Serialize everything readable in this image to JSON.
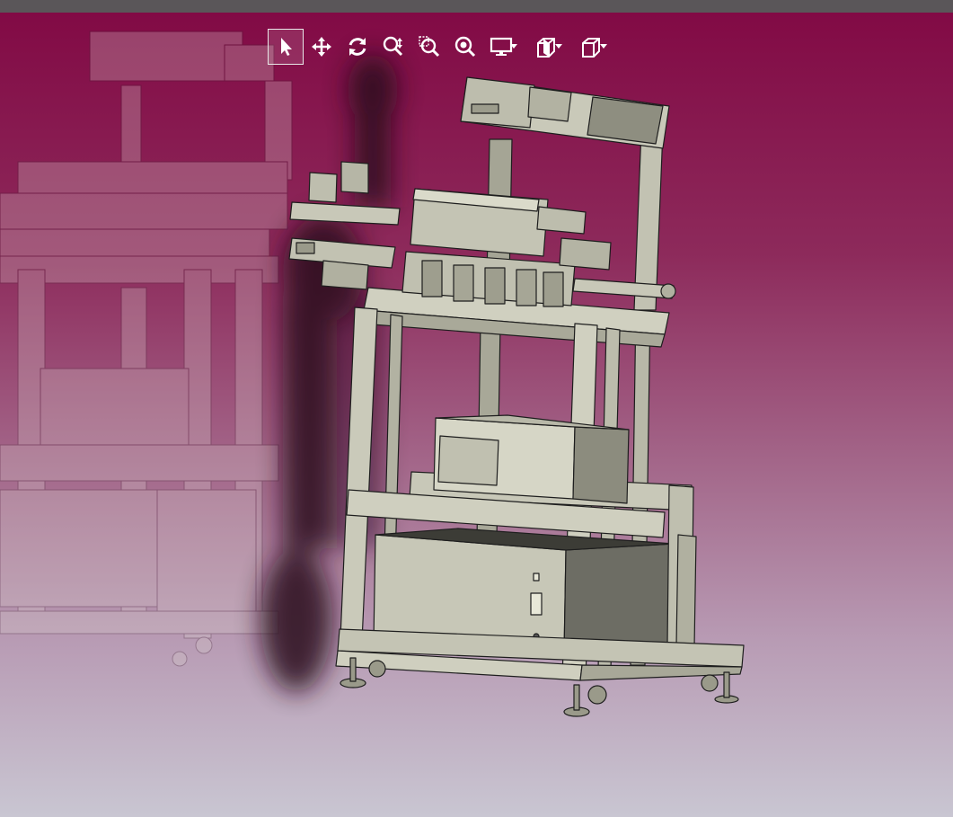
{
  "window": {
    "background_top": "#820a45",
    "background_bottom": "#c9c6d2",
    "topbar_color": "#5a5659"
  },
  "toolbar": {
    "buttons": [
      {
        "id": "select",
        "icon": "cursor-arrow-icon",
        "active": true
      },
      {
        "id": "pan",
        "icon": "move-arrows-icon",
        "active": false
      },
      {
        "id": "rotate",
        "icon": "rotate-icon",
        "active": false
      },
      {
        "id": "zoom",
        "icon": "zoom-updown-icon",
        "active": false
      },
      {
        "id": "zoom-window",
        "icon": "zoom-window-icon",
        "active": false
      },
      {
        "id": "zoom-fit",
        "icon": "zoom-fit-icon",
        "active": false
      },
      {
        "id": "display-mode",
        "icon": "monitor-icon",
        "active": false,
        "dropdown": true
      },
      {
        "id": "section",
        "icon": "section-cube-icon",
        "active": false,
        "dropdown": true
      },
      {
        "id": "view-orientation",
        "icon": "iso-cube-icon",
        "active": false,
        "dropdown": true
      }
    ]
  },
  "model": {
    "part_color": "#c0c0b0",
    "edge_color": "#202020",
    "name": "cad-workstation-cart-assembly"
  }
}
